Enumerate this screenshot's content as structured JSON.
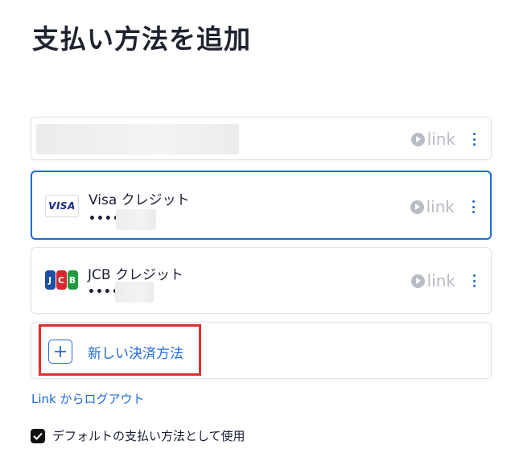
{
  "page": {
    "title": "支払い方法を追加"
  },
  "cards": [
    {
      "name": "",
      "dots": "",
      "badge": "link",
      "brand_icon": "none",
      "selected": false
    },
    {
      "name": "Visa クレジット",
      "dots": "••••",
      "badge": "link",
      "brand_icon": "visa-logo",
      "brand_text": "VISA",
      "selected": true
    },
    {
      "name": "JCB クレジット",
      "dots": "••••",
      "badge": "link",
      "brand_icon": "jcb-logo",
      "brand_letters": [
        "J",
        "C",
        "B"
      ],
      "selected": false
    }
  ],
  "add_new": {
    "label": "新しい決済方法",
    "icon": "plus-icon"
  },
  "logout": {
    "label": "Link からログアウト"
  },
  "default_option": {
    "label": "デフォルトの支払い方法として使用",
    "checked": true
  },
  "colors": {
    "accent": "#1f6bd6",
    "highlight": "#e32d2d",
    "link_badge": "#b8bcc4",
    "jcb_blue": "#1d4fa3",
    "jcb_red": "#d8262c",
    "jcb_green": "#1f9a3e"
  }
}
